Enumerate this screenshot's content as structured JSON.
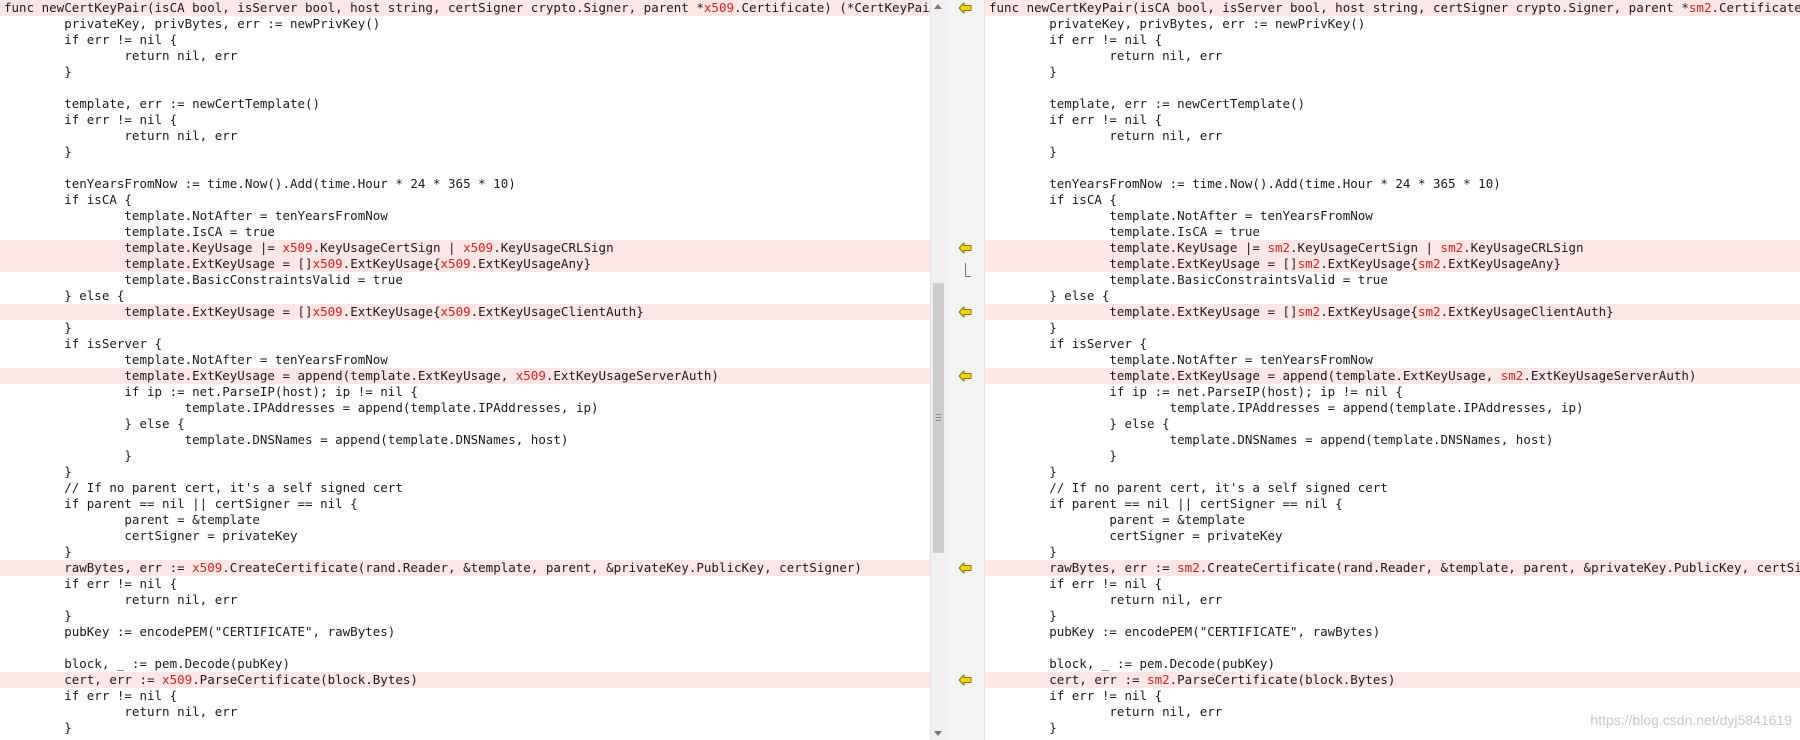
{
  "left": {
    "lines": [
      {
        "changed": true,
        "segs": [
          "func newCertKeyPair(isCA bool, isServer bool, host string, certSigner crypto.Signer, parent *",
          {
            "d": "x509"
          },
          ".Certificate) (*CertKeyPair, error) {"
        ]
      },
      {
        "changed": false,
        "segs": [
          "\tprivateKey, privBytes, err := newPrivKey()"
        ]
      },
      {
        "changed": false,
        "segs": [
          "\tif err != nil {"
        ]
      },
      {
        "changed": false,
        "segs": [
          "\t\treturn nil, err"
        ]
      },
      {
        "changed": false,
        "segs": [
          "\t}"
        ]
      },
      {
        "changed": false,
        "segs": [
          ""
        ]
      },
      {
        "changed": false,
        "segs": [
          "\ttemplate, err := newCertTemplate()"
        ]
      },
      {
        "changed": false,
        "segs": [
          "\tif err != nil {"
        ]
      },
      {
        "changed": false,
        "segs": [
          "\t\treturn nil, err"
        ]
      },
      {
        "changed": false,
        "segs": [
          "\t}"
        ]
      },
      {
        "changed": false,
        "segs": [
          ""
        ]
      },
      {
        "changed": false,
        "segs": [
          "\ttenYearsFromNow := time.Now().Add(time.Hour * 24 * 365 * 10)"
        ]
      },
      {
        "changed": false,
        "segs": [
          "\tif isCA {"
        ]
      },
      {
        "changed": false,
        "segs": [
          "\t\ttemplate.NotAfter = tenYearsFromNow"
        ]
      },
      {
        "changed": false,
        "segs": [
          "\t\ttemplate.IsCA = true"
        ]
      },
      {
        "changed": true,
        "segs": [
          "\t\ttemplate.KeyUsage |= ",
          {
            "d": "x509"
          },
          ".KeyUsageCertSign | ",
          {
            "d": "x509"
          },
          ".KeyUsageCRLSign"
        ]
      },
      {
        "changed": true,
        "segs": [
          "\t\ttemplate.ExtKeyUsage = []",
          {
            "d": "x509"
          },
          ".ExtKeyUsage{",
          {
            "d": "x509"
          },
          ".ExtKeyUsageAny}"
        ]
      },
      {
        "changed": false,
        "segs": [
          "\t\ttemplate.BasicConstraintsValid = true"
        ]
      },
      {
        "changed": false,
        "segs": [
          "\t} else {"
        ]
      },
      {
        "changed": true,
        "segs": [
          "\t\ttemplate.ExtKeyUsage = []",
          {
            "d": "x509"
          },
          ".ExtKeyUsage{",
          {
            "d": "x509"
          },
          ".ExtKeyUsageClientAuth}"
        ]
      },
      {
        "changed": false,
        "segs": [
          "\t}"
        ]
      },
      {
        "changed": false,
        "segs": [
          "\tif isServer {"
        ]
      },
      {
        "changed": false,
        "segs": [
          "\t\ttemplate.NotAfter = tenYearsFromNow"
        ]
      },
      {
        "changed": true,
        "segs": [
          "\t\ttemplate.ExtKeyUsage = append(template.ExtKeyUsage, ",
          {
            "d": "x509"
          },
          ".ExtKeyUsageServerAuth)"
        ]
      },
      {
        "changed": false,
        "segs": [
          "\t\tif ip := net.ParseIP(host); ip != nil {"
        ]
      },
      {
        "changed": false,
        "segs": [
          "\t\t\ttemplate.IPAddresses = append(template.IPAddresses, ip)"
        ]
      },
      {
        "changed": false,
        "segs": [
          "\t\t} else {"
        ]
      },
      {
        "changed": false,
        "segs": [
          "\t\t\ttemplate.DNSNames = append(template.DNSNames, host)"
        ]
      },
      {
        "changed": false,
        "segs": [
          "\t\t}"
        ]
      },
      {
        "changed": false,
        "segs": [
          "\t}"
        ]
      },
      {
        "changed": false,
        "segs": [
          "\t// If no parent cert, it's a self signed cert"
        ]
      },
      {
        "changed": false,
        "segs": [
          "\tif parent == nil || certSigner == nil {"
        ]
      },
      {
        "changed": false,
        "segs": [
          "\t\tparent = &template"
        ]
      },
      {
        "changed": false,
        "segs": [
          "\t\tcertSigner = privateKey"
        ]
      },
      {
        "changed": false,
        "segs": [
          "\t}"
        ]
      },
      {
        "changed": true,
        "segs": [
          "\trawBytes, err := ",
          {
            "d": "x509"
          },
          ".CreateCertificate(rand.Reader, &template, parent, &privateKey.PublicKey, certSigner)"
        ]
      },
      {
        "changed": false,
        "segs": [
          "\tif err != nil {"
        ]
      },
      {
        "changed": false,
        "segs": [
          "\t\treturn nil, err"
        ]
      },
      {
        "changed": false,
        "segs": [
          "\t}"
        ]
      },
      {
        "changed": false,
        "segs": [
          "\tpubKey := encodePEM(\"CERTIFICATE\", rawBytes)"
        ]
      },
      {
        "changed": false,
        "segs": [
          ""
        ]
      },
      {
        "changed": false,
        "segs": [
          "\tblock, _ := pem.Decode(pubKey)"
        ]
      },
      {
        "changed": true,
        "segs": [
          "\tcert, err := ",
          {
            "d": "x509"
          },
          ".ParseCertificate(block.Bytes)"
        ]
      },
      {
        "changed": false,
        "segs": [
          "\tif err != nil {"
        ]
      },
      {
        "changed": false,
        "segs": [
          "\t\treturn nil, err"
        ]
      },
      {
        "changed": false,
        "segs": [
          "\t}"
        ]
      }
    ]
  },
  "right": {
    "lines": [
      {
        "changed": true,
        "segs": [
          "func newCertKeyPair(isCA bool, isServer bool, host string, certSigner crypto.Signer, parent *",
          {
            "d": "sm2"
          },
          ".Certificate) (*CertKeyPair, error) {"
        ]
      },
      {
        "changed": false,
        "segs": [
          "\tprivateKey, privBytes, err := newPrivKey()"
        ]
      },
      {
        "changed": false,
        "segs": [
          "\tif err != nil {"
        ]
      },
      {
        "changed": false,
        "segs": [
          "\t\treturn nil, err"
        ]
      },
      {
        "changed": false,
        "segs": [
          "\t}"
        ]
      },
      {
        "changed": false,
        "segs": [
          ""
        ]
      },
      {
        "changed": false,
        "segs": [
          "\ttemplate, err := newCertTemplate()"
        ]
      },
      {
        "changed": false,
        "segs": [
          "\tif err != nil {"
        ]
      },
      {
        "changed": false,
        "segs": [
          "\t\treturn nil, err"
        ]
      },
      {
        "changed": false,
        "segs": [
          "\t}"
        ]
      },
      {
        "changed": false,
        "segs": [
          ""
        ]
      },
      {
        "changed": false,
        "segs": [
          "\ttenYearsFromNow := time.Now().Add(time.Hour * 24 * 365 * 10)"
        ]
      },
      {
        "changed": false,
        "segs": [
          "\tif isCA {"
        ]
      },
      {
        "changed": false,
        "segs": [
          "\t\ttemplate.NotAfter = tenYearsFromNow"
        ]
      },
      {
        "changed": false,
        "segs": [
          "\t\ttemplate.IsCA = true"
        ]
      },
      {
        "changed": true,
        "segs": [
          "\t\ttemplate.KeyUsage |= ",
          {
            "d": "sm2"
          },
          ".KeyUsageCertSign | ",
          {
            "d": "sm2"
          },
          ".KeyUsageCRLSign"
        ]
      },
      {
        "changed": true,
        "segs": [
          "\t\ttemplate.ExtKeyUsage = []",
          {
            "d": "sm2"
          },
          ".ExtKeyUsage{",
          {
            "d": "sm2"
          },
          ".ExtKeyUsageAny}"
        ]
      },
      {
        "changed": false,
        "segs": [
          "\t\ttemplate.BasicConstraintsValid = true"
        ]
      },
      {
        "changed": false,
        "segs": [
          "\t} else {"
        ]
      },
      {
        "changed": true,
        "segs": [
          "\t\ttemplate.ExtKeyUsage = []",
          {
            "d": "sm2"
          },
          ".ExtKeyUsage{",
          {
            "d": "sm2"
          },
          ".ExtKeyUsageClientAuth}"
        ]
      },
      {
        "changed": false,
        "segs": [
          "\t}"
        ]
      },
      {
        "changed": false,
        "segs": [
          "\tif isServer {"
        ]
      },
      {
        "changed": false,
        "segs": [
          "\t\ttemplate.NotAfter = tenYearsFromNow"
        ]
      },
      {
        "changed": true,
        "segs": [
          "\t\ttemplate.ExtKeyUsage = append(template.ExtKeyUsage, ",
          {
            "d": "sm2"
          },
          ".ExtKeyUsageServerAuth)"
        ]
      },
      {
        "changed": false,
        "segs": [
          "\t\tif ip := net.ParseIP(host); ip != nil {"
        ]
      },
      {
        "changed": false,
        "segs": [
          "\t\t\ttemplate.IPAddresses = append(template.IPAddresses, ip)"
        ]
      },
      {
        "changed": false,
        "segs": [
          "\t\t} else {"
        ]
      },
      {
        "changed": false,
        "segs": [
          "\t\t\ttemplate.DNSNames = append(template.DNSNames, host)"
        ]
      },
      {
        "changed": false,
        "segs": [
          "\t\t}"
        ]
      },
      {
        "changed": false,
        "segs": [
          "\t}"
        ]
      },
      {
        "changed": false,
        "segs": [
          "\t// If no parent cert, it's a self signed cert"
        ]
      },
      {
        "changed": false,
        "segs": [
          "\tif parent == nil || certSigner == nil {"
        ]
      },
      {
        "changed": false,
        "segs": [
          "\t\tparent = &template"
        ]
      },
      {
        "changed": false,
        "segs": [
          "\t\tcertSigner = privateKey"
        ]
      },
      {
        "changed": false,
        "segs": [
          "\t}"
        ]
      },
      {
        "changed": true,
        "segs": [
          "\trawBytes, err := ",
          {
            "d": "sm2"
          },
          ".CreateCertificate(rand.Reader, &template, parent, &privateKey.PublicKey, certSigner)"
        ]
      },
      {
        "changed": false,
        "segs": [
          "\tif err != nil {"
        ]
      },
      {
        "changed": false,
        "segs": [
          "\t\treturn nil, err"
        ]
      },
      {
        "changed": false,
        "segs": [
          "\t}"
        ]
      },
      {
        "changed": false,
        "segs": [
          "\tpubKey := encodePEM(\"CERTIFICATE\", rawBytes)"
        ]
      },
      {
        "changed": false,
        "segs": [
          ""
        ]
      },
      {
        "changed": false,
        "segs": [
          "\tblock, _ := pem.Decode(pubKey)"
        ]
      },
      {
        "changed": true,
        "segs": [
          "\tcert, err := ",
          {
            "d": "sm2"
          },
          ".ParseCertificate(block.Bytes)"
        ]
      },
      {
        "changed": false,
        "segs": [
          "\tif err != nil {"
        ]
      },
      {
        "changed": false,
        "segs": [
          "\t\treturn nil, err"
        ]
      },
      {
        "changed": false,
        "segs": [
          "\t}"
        ]
      }
    ]
  },
  "gutter": {
    "marker_icon": "left-arrow-icon",
    "marker_lines": [
      0,
      15,
      19,
      23,
      35,
      42
    ],
    "bracket_lines": [
      15,
      16
    ]
  },
  "watermark": "https://blog.csdn.net/dyj5841619",
  "colors": {
    "changed_line_bg": "#fde6e6",
    "diff_token": "#e0201d",
    "marker_fill": "#f5d800",
    "marker_stroke": "#8a6d00"
  }
}
